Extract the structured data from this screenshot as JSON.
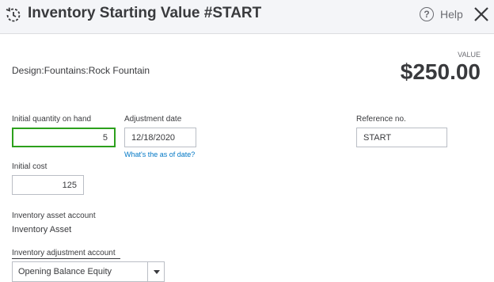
{
  "header": {
    "title": "Inventory Starting Value  #START",
    "help_label": "Help",
    "help_glyph": "?",
    "icons": {
      "history": "history-clock-icon",
      "help": "help-circle-icon",
      "close": "close-icon"
    }
  },
  "item": {
    "name": "Design:Fountains:Rock Fountain"
  },
  "value": {
    "label": "VALUE",
    "amount": "$250.00"
  },
  "form": {
    "quantity": {
      "label": "Initial quantity on hand",
      "value": "5"
    },
    "adjustment_date": {
      "label": "Adjustment date",
      "value": "12/18/2020",
      "link": "What's the as of date?"
    },
    "reference": {
      "label": "Reference no.",
      "value": "START"
    },
    "initial_cost": {
      "label": "Initial cost",
      "value": "125"
    },
    "asset_account": {
      "label": "Inventory asset account",
      "value": "Inventory Asset"
    },
    "adjustment_account": {
      "label": "Inventory adjustment account",
      "value": "Opening Balance Equity"
    }
  },
  "colors": {
    "focus_border": "#2ca01c",
    "link": "#0077c5",
    "header_bg": "#f4f5f8",
    "text": "#393a3d"
  }
}
